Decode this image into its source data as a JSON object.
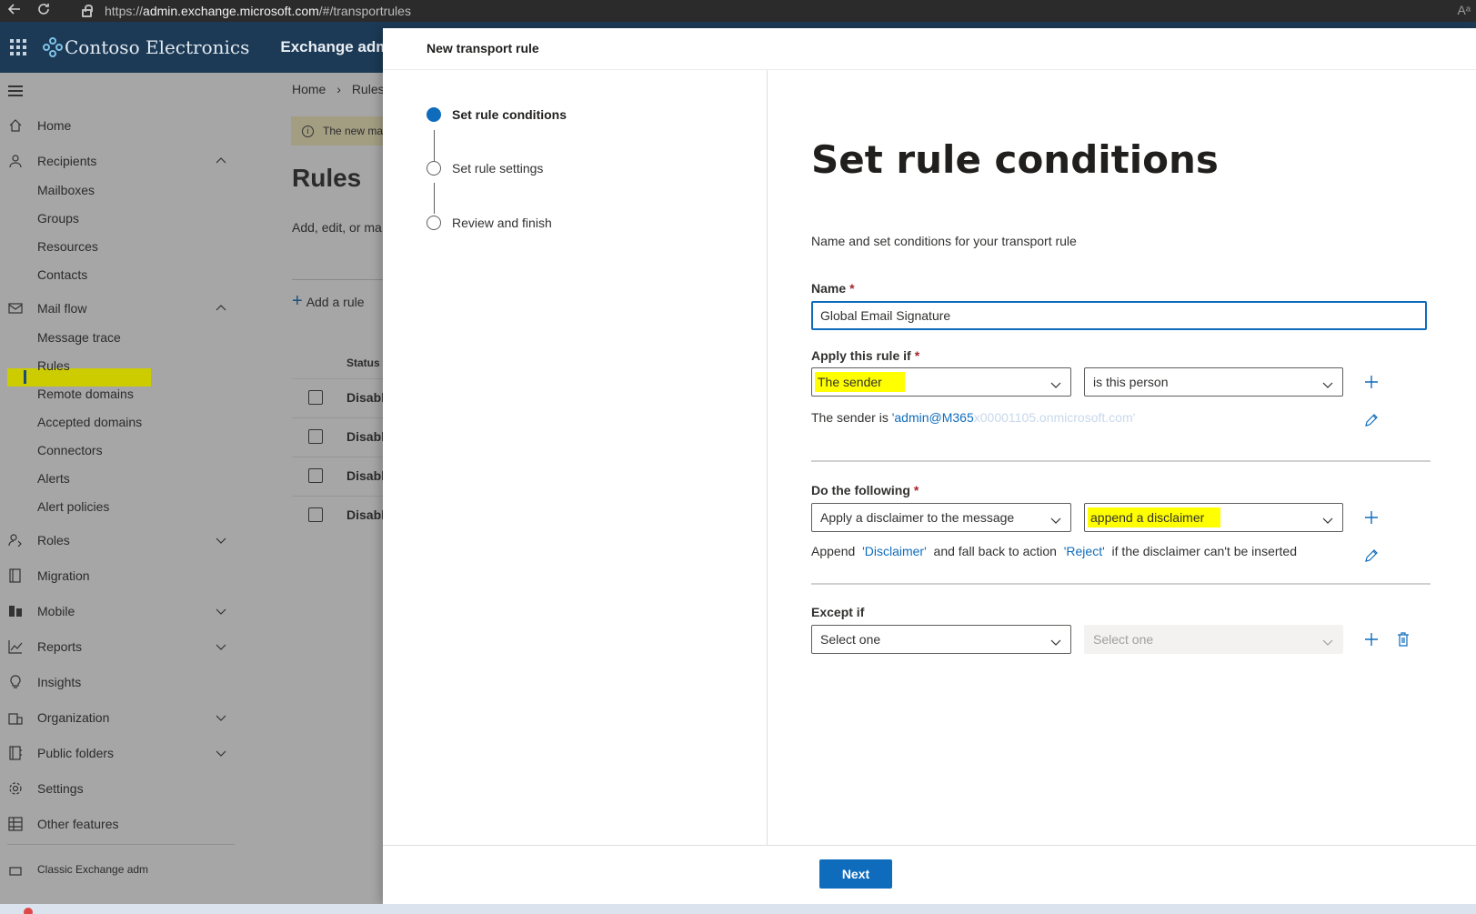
{
  "browser": {
    "url_prefix": "https://",
    "url_host": "admin.exchange.microsoft.com",
    "url_path": "/#/transportrules",
    "read_aloud": "Aᵃ"
  },
  "header": {
    "brand": "Contoso Electronics",
    "app_title": "Exchange admin ce"
  },
  "leftnav": {
    "items": [
      {
        "label": "Home",
        "icon": "home-icon"
      },
      {
        "label": "Recipients",
        "icon": "person-icon",
        "expanded": true
      },
      {
        "label": "Mail flow",
        "icon": "mail-icon",
        "expanded": true
      },
      {
        "label": "Roles",
        "icon": "roles-icon",
        "expanded": false
      },
      {
        "label": "Migration",
        "icon": "migration-icon"
      },
      {
        "label": "Mobile",
        "icon": "mobile-icon",
        "expanded": false
      },
      {
        "label": "Reports",
        "icon": "chart-icon",
        "expanded": false
      },
      {
        "label": "Insights",
        "icon": "lightbulb-icon"
      },
      {
        "label": "Organization",
        "icon": "organization-icon",
        "expanded": false
      },
      {
        "label": "Public folders",
        "icon": "folder-icon",
        "expanded": false
      },
      {
        "label": "Settings",
        "icon": "gear-icon"
      },
      {
        "label": "Other features",
        "icon": "grid-icon"
      },
      {
        "label": "Classic Exchange adm",
        "icon": "exchange-icon"
      }
    ],
    "recipients_sub": [
      "Mailboxes",
      "Groups",
      "Resources",
      "Contacts"
    ],
    "mailflow_sub": [
      "Message trace",
      "Rules",
      "Remote domains",
      "Accepted domains",
      "Connectors",
      "Alerts",
      "Alert policies"
    ],
    "active_sub": "Rules"
  },
  "background_page": {
    "breadcrumb_home": "Home",
    "breadcrumb_separator": "›",
    "breadcrumb_current": "Rules",
    "banner_text": "The new ma",
    "title": "Rules",
    "description": "Add, edit, or ma",
    "add_rule": "Add a rule",
    "status_header": "Status",
    "rows": [
      "Disabl",
      "Disabl",
      "Disabl",
      "Disabl"
    ]
  },
  "panel": {
    "title": "New transport rule",
    "steps": [
      {
        "label": "Set rule conditions",
        "active": true
      },
      {
        "label": "Set rule settings",
        "active": false
      },
      {
        "label": "Review and finish",
        "active": false
      }
    ],
    "heading": "Set rule conditions",
    "description": "Name and set conditions for your transport rule",
    "name_label": "Name",
    "required_marker": "*",
    "name_value": "Global Email Signature",
    "apply_label": "Apply this rule if",
    "apply_condition": "The sender",
    "apply_predicate": "is this person",
    "apply_summary_prefix": "The sender is",
    "apply_summary_link": "'admin@M365",
    "apply_summary_fade": "x00001105.onmicrosoft.com'",
    "do_label": "Do the following",
    "do_action": "Apply a disclaimer to the message",
    "do_subaction": "append a disclaimer",
    "do_summary": {
      "append": "Append",
      "disclaimer_link": "'Disclaimer'",
      "middle": "and fall back to action",
      "reject_link": "'Reject'",
      "tail": "if the disclaimer can't be inserted"
    },
    "except_label": "Except if",
    "except_select": "Select one",
    "except_select_disabled": "Select one",
    "next_button": "Next"
  },
  "colors": {
    "accent": "#0f6cbd",
    "header_bg": "#1c3a56",
    "highlight": "#ffff00",
    "required": "#a4262c"
  }
}
